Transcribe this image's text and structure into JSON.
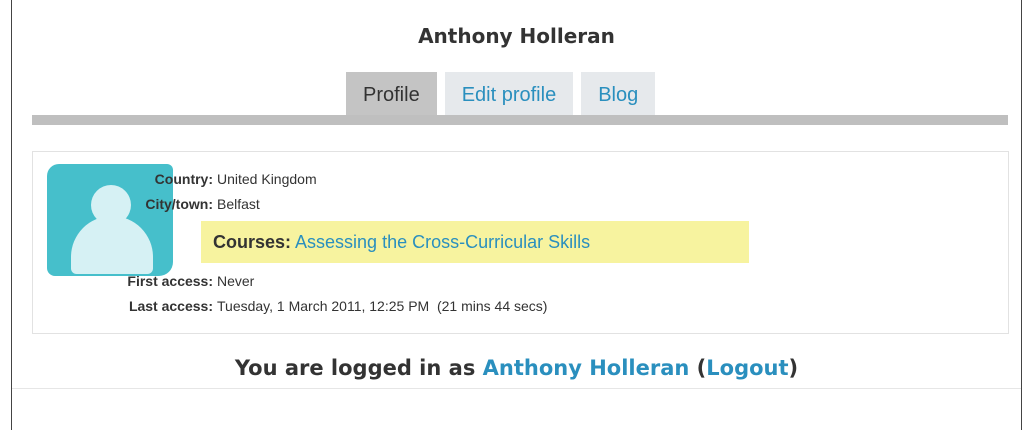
{
  "user": {
    "full_name": "Anthony Holleran"
  },
  "tabs": [
    {
      "label": "Profile",
      "active": true
    },
    {
      "label": "Edit profile",
      "active": false
    },
    {
      "label": "Blog",
      "active": false
    }
  ],
  "profile": {
    "avatar_icon": "user-avatar-icon",
    "fields": {
      "country": {
        "label": "Country:",
        "value": "United Kingdom"
      },
      "city": {
        "label": "City/town:",
        "value": "Belfast"
      },
      "courses": {
        "label": "Courses:",
        "value": "Assessing the Cross-Curricular Skills"
      },
      "first_access": {
        "label": "First access:",
        "value": "Never"
      },
      "last_access": {
        "label": "Last access:",
        "value": "Tuesday, 1 March 2011, 12:25 PM  (21 mins 44 secs)"
      }
    }
  },
  "footer": {
    "prefix": "You are logged in as",
    "user_link": "Anthony Holleran",
    "open_paren": "(",
    "logout_label": "Logout",
    "close_paren": ")"
  },
  "colors": {
    "link": "#2a8fbe",
    "highlight": "#f7f39f",
    "avatar": "#46bfcb",
    "tab_active": "#c4c4c4",
    "tab_inactive": "#e6e9ec"
  }
}
